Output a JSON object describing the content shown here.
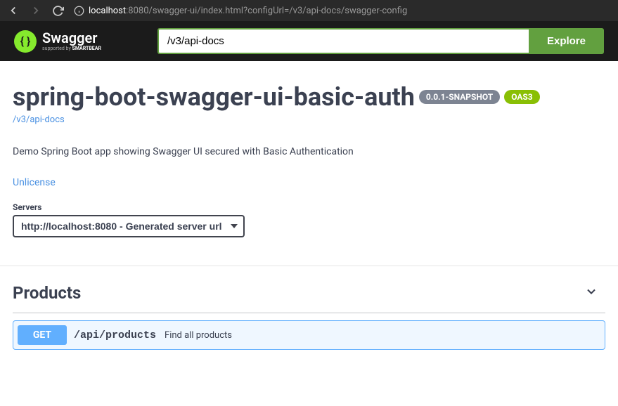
{
  "browser": {
    "url_host": "localhost",
    "url_rest": ":8080/swagger-ui/index.html?configUrl=/v3/api-docs/swagger-config"
  },
  "topbar": {
    "logo_main": "Swagger",
    "logo_sub_prefix": "supported by",
    "logo_sub_brand": "SMARTBEAR",
    "search_value": "/v3/api-docs",
    "explore_label": "Explore"
  },
  "info": {
    "title": "spring-boot-swagger-ui-basic-auth",
    "version": "0.0.1-SNAPSHOT",
    "oas": "OAS3",
    "spec_link": "/v3/api-docs",
    "description": "Demo Spring Boot app showing Swagger UI secured with Basic Authentication",
    "license": "Unlicense"
  },
  "servers": {
    "label": "Servers",
    "selected": "http://localhost:8080 - Generated server url"
  },
  "tag": {
    "name": "Products"
  },
  "operation": {
    "method": "GET",
    "path": "/api/products",
    "summary": "Find all products"
  }
}
